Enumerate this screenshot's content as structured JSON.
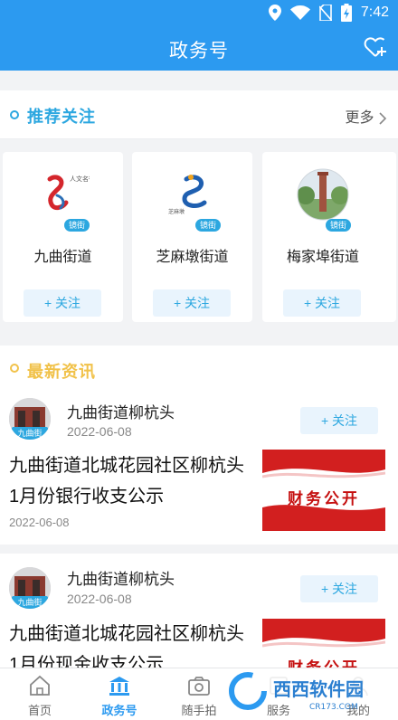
{
  "status_bar": {
    "time": "7:42"
  },
  "header": {
    "title": "政务号",
    "action_icon": "heart-plus-icon"
  },
  "recommend": {
    "title": "推荐关注",
    "more": "更多",
    "cards": [
      {
        "name": "九曲街道",
        "follow": "+ 关注",
        "badge": "镜街",
        "logo_text": "人文名街"
      },
      {
        "name": "芝麻墩街道",
        "follow": "+ 关注",
        "badge": "镜街",
        "logo_text": "芝麻墩"
      },
      {
        "name": "梅家埠街道",
        "follow": "+ 关注",
        "badge": "镜街"
      }
    ]
  },
  "news": {
    "title": "最新资讯",
    "items": [
      {
        "source": "九曲街道柳杭头",
        "source_date": "2022-06-08",
        "follow": "+ 关注",
        "avatar_badge": "九曲街",
        "text": "九曲街道北城花园社区柳杭头1月份银行收支公示",
        "date": "2022-06-08",
        "thumb_label": "财务公开"
      },
      {
        "source": "九曲街道柳杭头",
        "source_date": "2022-06-08",
        "follow": "+ 关注",
        "avatar_badge": "九曲街",
        "text": "九曲街道北城花园社区柳杭头1月份现金收支公示",
        "thumb_label": "财务公开"
      }
    ]
  },
  "bottom_nav": [
    {
      "label": "首页",
      "icon": "home-icon",
      "active": false
    },
    {
      "label": "政务号",
      "icon": "government-building-icon",
      "active": true
    },
    {
      "label": "随手拍",
      "icon": "camera-icon",
      "active": false
    },
    {
      "label": "服务",
      "icon": "service-icon",
      "active": false
    },
    {
      "label": "我的",
      "icon": "user-icon",
      "active": false
    }
  ],
  "watermark": {
    "text": "西西软件园",
    "url_text": "CR173.COM"
  },
  "colors": {
    "primary": "#2c9af0",
    "accent": "#2ca7e0",
    "news_title": "#f1c24a",
    "thumb_red": "#d62020"
  }
}
